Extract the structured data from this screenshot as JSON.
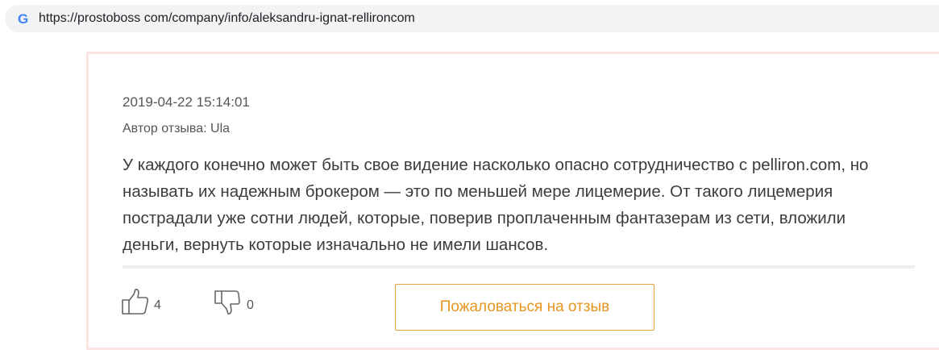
{
  "browser": {
    "url": "https://prostoboss com/company/info/aleksandru-ignat-rellironcom",
    "logo_icon": "google-g-icon"
  },
  "review": {
    "date": "2019-04-22 15:14:01",
    "author_line": "Автор отзыва: Ula",
    "text": "У каждого конечно может быть свое видение насколько опасно сотрудничество с pelliron.com, но называть их надежным брокером — это по меньшей мере лицемерие. От такого лицемерия пострадали уже сотни людей, которые, поверив проплаченным фантазерам из сети, вложили деньги, вернуть которые изначально не имели шансов.",
    "likes": "4",
    "dislikes": "0",
    "like_icon": "thumbs-up-icon",
    "dislike_icon": "thumbs-down-icon",
    "complain_label": "Пожаловаться на отзыв"
  },
  "colors": {
    "card_border": "#fbe5e3",
    "accent": "#e69520",
    "address_bar_bg": "#f1f3f4"
  }
}
